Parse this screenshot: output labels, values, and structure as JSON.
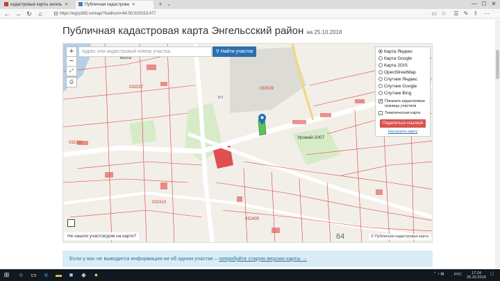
{
  "browser": {
    "tabs": [
      {
        "label": "кадастровые карты энгель",
        "active": false
      },
      {
        "label": "Публичная кадастрова",
        "active": true
      }
    ],
    "new_tab": "+",
    "tab_list": "⌄",
    "url": "https://egrp365.ru/map/?kadnum=64:50:020153:477",
    "nav": {
      "back": "←",
      "forward": "→",
      "refresh": "↻",
      "home": "⌂"
    },
    "window": {
      "minimize": "—",
      "maximize": "☐",
      "close": "✕"
    }
  },
  "page": {
    "title": "Публичная кадастровая карта Энгельсский район",
    "date_prefix": "на 25.10.2018"
  },
  "map": {
    "zoom_in": "+",
    "zoom_out": "−",
    "search_placeholder": "Адрес или кадастровый номер участка",
    "search_value": "",
    "search_button": "Найти участок",
    "layers": [
      {
        "label": "Карта Яндекс",
        "selected": true
      },
      {
        "label": "Карта Google",
        "selected": false
      },
      {
        "label": "Карта 2GIS",
        "selected": false
      },
      {
        "label": "OpenStreetMap",
        "selected": false
      },
      {
        "label": "Спутник Яндекс",
        "selected": false
      },
      {
        "label": "Спутник Google",
        "selected": false
      },
      {
        "label": "Спутник Bing",
        "selected": false
      }
    ],
    "show_borders_label": "Показать кадастровые границы участков",
    "show_borders_checked": true,
    "thematic_label": "Тематическая карта",
    "thematic_checked": false,
    "share_button": "Поделиться ссылкой",
    "setup_link": "Настроить карту",
    "not_found_link": "Не нашли участок/дом на карте?",
    "copyright": "© Публичная кадастровая карта",
    "labels": {
      "volga": "Волга",
      "q1": "032029",
      "q2": "032027",
      "q3": "032301",
      "q4": "032405",
      "q5": "032310",
      "area": "Урожай-2007",
      "num64": "64",
      "kp": "КП"
    }
  },
  "alert": {
    "text": "Если у вас не выводится информация ни об одном участке – ",
    "link": "попробуйте старую версию карты →"
  },
  "taskbar": {
    "lang": "РУС",
    "time": "17:24",
    "date": "25.10.2018"
  },
  "colors": {
    "accent": "#2a6fb0",
    "share": "#d9534f",
    "parcel": "#e03c3c",
    "alert_bg": "#d9edf7"
  }
}
